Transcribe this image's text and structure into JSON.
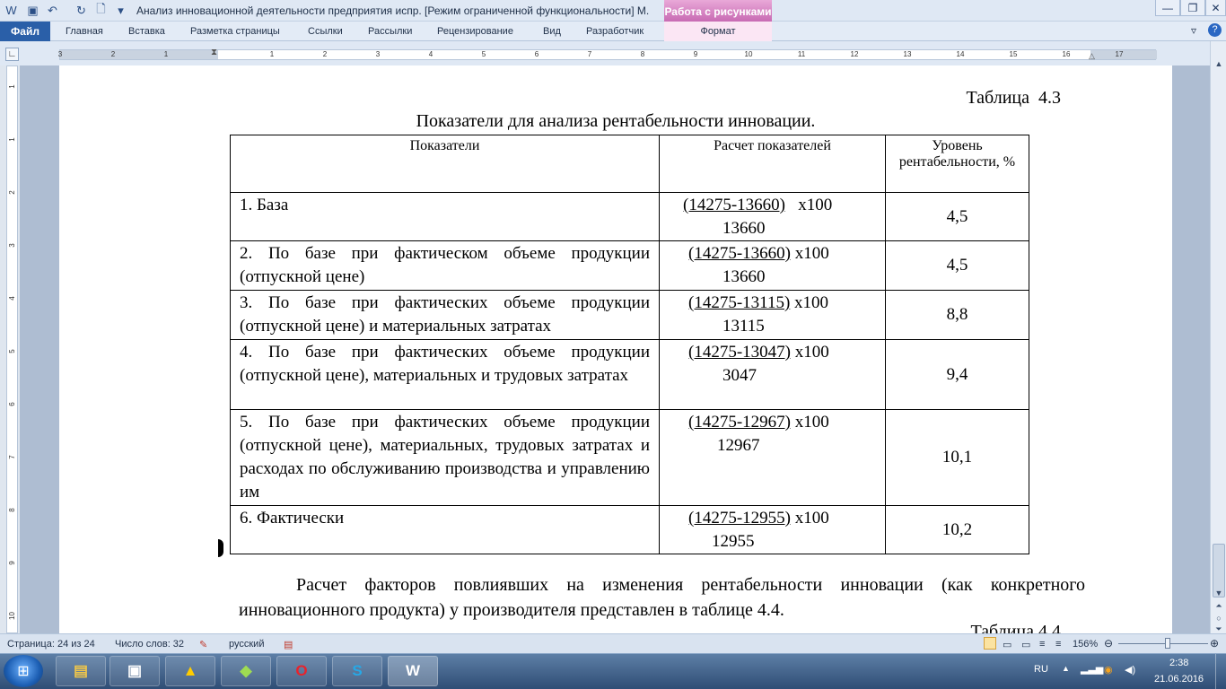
{
  "window": {
    "title": "Анализ инновационной деятельности предприятия испр. [Режим ограниченной функциональности] M.",
    "context_tab": "Работа с рисунками",
    "controls": {
      "minimize": "—",
      "maximize": "❐",
      "close": "✕"
    }
  },
  "ribbon": {
    "file_tab": "Файл",
    "tabs": [
      "Главная",
      "Вставка",
      "Разметка страницы",
      "Ссылки",
      "Рассылки",
      "Рецензирование",
      "Вид",
      "Разработчик"
    ],
    "format_tab": "Формат"
  },
  "ruler": {
    "h_ticks": [
      "3",
      "2",
      "1",
      "1",
      "2",
      "3",
      "4",
      "5",
      "6",
      "7",
      "8",
      "9",
      "10",
      "11",
      "12",
      "13",
      "14",
      "15",
      "16",
      "17"
    ],
    "v_ticks": [
      "1",
      "1",
      "2",
      "3",
      "4",
      "5",
      "6",
      "7",
      "8",
      "9",
      "10"
    ]
  },
  "document": {
    "table_number": "Таблица  4.3",
    "table_caption": "Показатели для анализа рентабельности инновации.",
    "headers": [
      "Показатели",
      "Расчет показателей",
      "Уровень рентабельности, %"
    ],
    "rows": [
      {
        "label": "1. База",
        "calc_num": "(14275-13660)",
        "calc_mult": "   х100",
        "calc_den": "13660",
        "level": "4,5"
      },
      {
        "label": "2. По базе при фактическом объеме продукции (отпускной цене)",
        "calc_num": "(14275-13660)",
        "calc_mult": " х100",
        "calc_den": "13660",
        "level": "4,5"
      },
      {
        "label": "3. По базе при фактических объеме продукции (отпускной цене) и материальных затратах",
        "calc_num": "(14275-13115)",
        "calc_mult": " х100",
        "calc_den": "13115",
        "level": "8,8"
      },
      {
        "label": "4. По базе при фактических объеме продукции (отпускной цене),  материальных и трудовых затратах",
        "calc_num": "(14275-13047)",
        "calc_mult": " х100",
        "calc_den": "3047",
        "level": "9,4"
      },
      {
        "label": "5. По базе при фактических объеме продукции (отпускной цене),  материальных, трудовых затратах и расходах по обслуживанию производства и управлению им",
        "calc_num": "(14275-12967)",
        "calc_mult": " х100",
        "calc_den": "12967",
        "level": "10,1"
      },
      {
        "label": "6. Фактически",
        "calc_num": "(14275-12955)",
        "calc_mult": " х100",
        "calc_den": "12955",
        "level": "10,2"
      }
    ],
    "paragraph": "Расчет факторов повлиявших на изменения рентабельности инновации (как конкретного инновационного продукта) у производителя представлен в таблице 4.4.",
    "next_table_number": "Таблица  4.4"
  },
  "status": {
    "page": "Страница: 24 из 24",
    "words": "Число слов: 32",
    "language": "русский",
    "zoom": "156%"
  },
  "taskbar": {
    "lang": "RU",
    "time": "2:38",
    "date": "21.06.2016"
  }
}
